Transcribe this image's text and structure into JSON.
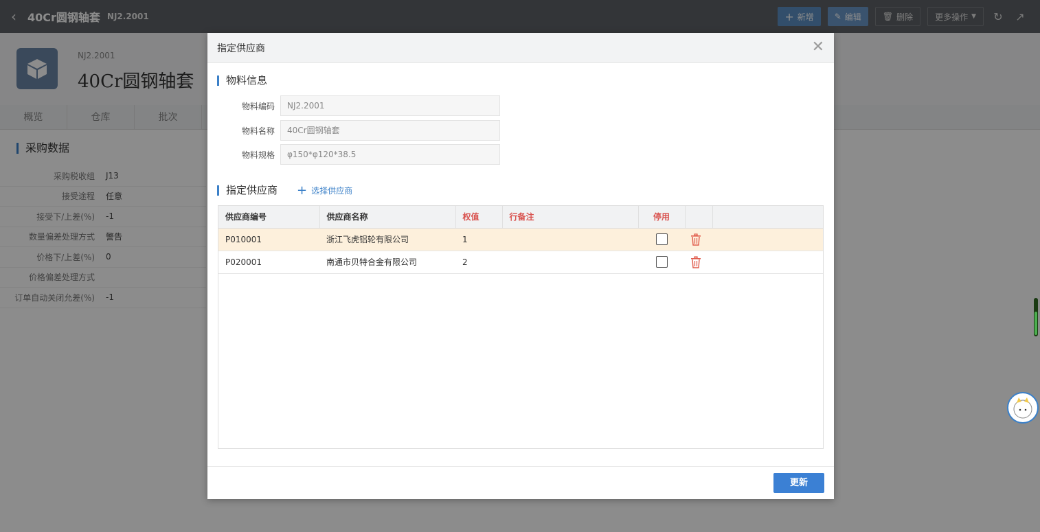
{
  "topbar": {
    "back_icon": "chevron-left",
    "title": "40Cr圆钢轴套",
    "code": "NJ2.2001",
    "actions": {
      "add": "新增",
      "edit": "编辑",
      "delete": "删除",
      "more": "更多操作"
    }
  },
  "header": {
    "code": "NJ2.2001",
    "name": "40Cr圆钢轴套"
  },
  "tabs": [
    "概览",
    "仓库",
    "批次"
  ],
  "purchase": {
    "title": "采购数据",
    "fields": [
      {
        "label": "采购税收组",
        "value": "J13"
      },
      {
        "label": "接受途程",
        "value": "任意"
      },
      {
        "label": "接受下/上差(%)",
        "value": "-1"
      },
      {
        "label": "数量偏差处理方式",
        "value": "警告"
      },
      {
        "label": "价格下/上差(%)",
        "value": "0"
      },
      {
        "label": "价格偏差处理方式",
        "value": ""
      },
      {
        "label": "订单自动关闭允差(%)",
        "value": "-1"
      }
    ]
  },
  "modal": {
    "title": "指定供应商",
    "material_section": "物料信息",
    "fields": [
      {
        "label": "物料编码",
        "value": "NJ2.2001"
      },
      {
        "label": "物料名称",
        "value": "40Cr圆钢轴套"
      },
      {
        "label": "物料规格",
        "value": "φ150*φ120*38.5"
      }
    ],
    "supplier_section": "指定供应商",
    "add_supplier": "选择供应商",
    "columns": {
      "code": "供应商编号",
      "name": "供应商名称",
      "weight": "权值",
      "note": "行备注",
      "disabled": "停用"
    },
    "rows": [
      {
        "code": "P010001",
        "name": "浙江飞虎铝轮有限公司",
        "weight": "1",
        "note": "",
        "disabled": false
      },
      {
        "code": "P020001",
        "name": "南通市贝特合金有限公司",
        "weight": "2",
        "note": "",
        "disabled": false
      }
    ],
    "update_button": "更新"
  },
  "colors": {
    "accent": "#3b80c8",
    "required_header": "#d9534f",
    "highlight_row": "#fdf0dc"
  }
}
